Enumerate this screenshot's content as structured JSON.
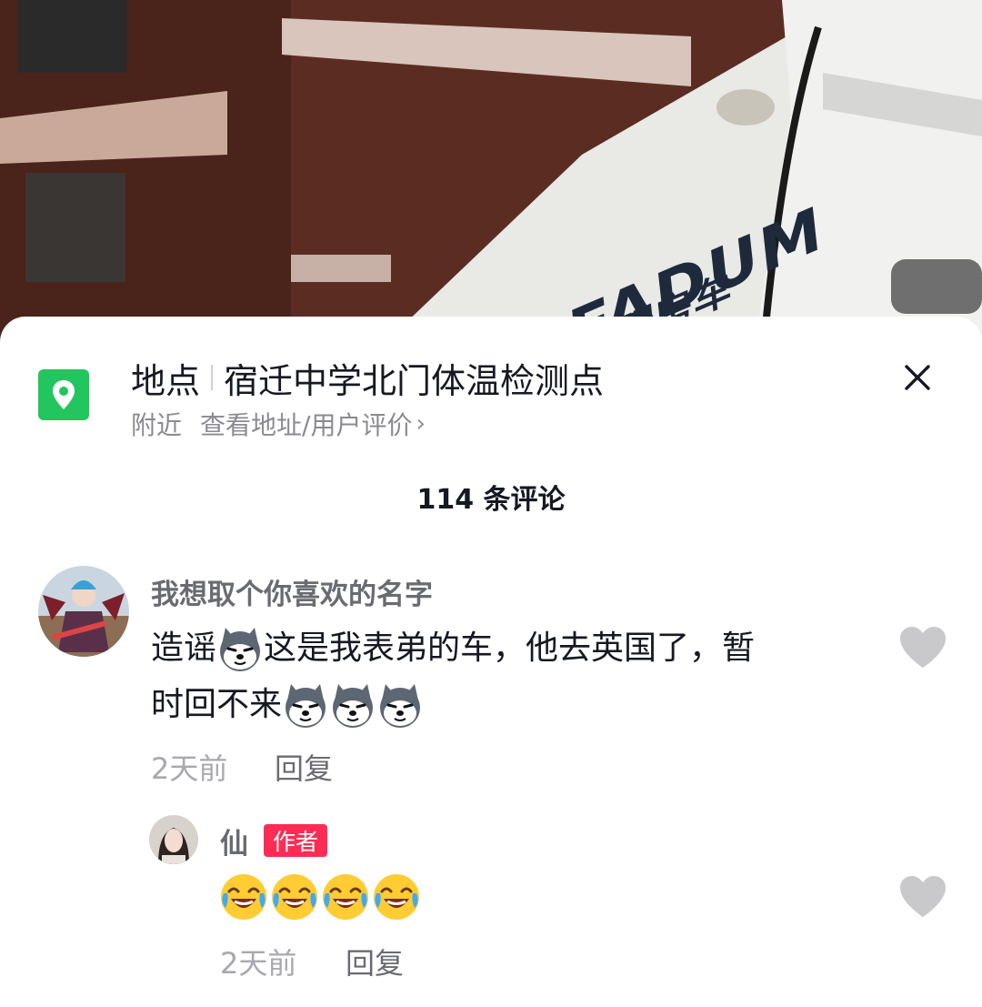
{
  "video": {
    "brand_text": "FADUM",
    "sub_text": "速明房车"
  },
  "poi": {
    "icon": "location-pin-icon",
    "label": "地点",
    "name": "宿迁中学北门体温检测点",
    "nearby": "附近",
    "link": "查看地址/用户评价",
    "link_chevron": "›",
    "color": "#22c55e"
  },
  "comments_header": {
    "count_text": "114 条评论"
  },
  "comments": [
    {
      "username": "我想取个你喜欢的名字",
      "text_line1_a": "造谣",
      "text_line1_b": "这是我表弟的车，他去英国了，暂",
      "text_line2": "时回不来",
      "emoji": "husky-dog-emoji",
      "time": "2天前",
      "reply_label": "回复",
      "like_icon": "heart-icon"
    },
    {
      "username": "仙",
      "tag": "作者",
      "emoji": "laugh-cry-emoji",
      "time": "2天前",
      "reply_label": "回复",
      "like_icon": "heart-icon"
    }
  ],
  "colors": {
    "author_tag": "#fe2c55",
    "heart": "#c9c9cc"
  }
}
